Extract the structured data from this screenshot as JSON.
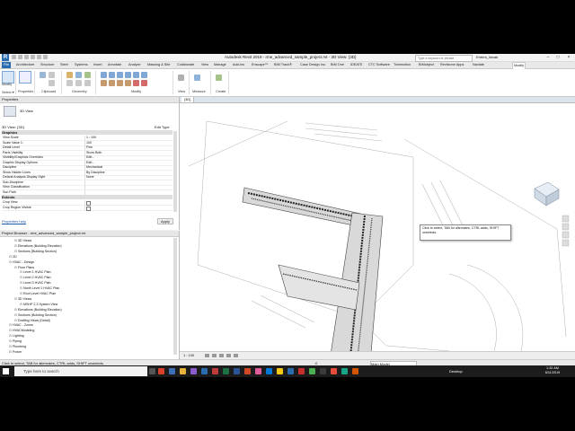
{
  "window": {
    "title": "Autodesk Revit 2019 - rme_advanced_sample_project.rvt - 3D View: {3D}",
    "search_placeholder": "Type a keyword or phrase",
    "user": "Erdem_ilovak"
  },
  "tabs": [
    "File",
    "Architecture",
    "Structure",
    "Steel",
    "Systems",
    "Insert",
    "Annotate",
    "Analyze",
    "Massing & Site",
    "Collaborate",
    "View",
    "Manage",
    "Add-Ins",
    "Enscape™",
    "BIM Track®",
    "Cove.Tool",
    "Case Design Inc.",
    "BIM One",
    "IDEATE",
    "CTC Software",
    "Twinmotion",
    "BIMobject",
    "Naviate",
    "Revitzone Apps",
    "Modify"
  ],
  "ribbon": {
    "panels": [
      "Select ▾",
      "Properties",
      "Clipboard",
      "Geometry",
      "Modify",
      "View",
      "Measure",
      "Create"
    ],
    "modify_label": "Modify"
  },
  "properties": {
    "header": "Properties",
    "type_name": "3D View",
    "instance_selector": "3D View: {3D}",
    "edit_type": "Edit Type",
    "section_graphics": "Graphics",
    "rows": [
      {
        "k": "View Scale",
        "v": "1 : 100"
      },
      {
        "k": "Scale Value    1:",
        "v": "100"
      },
      {
        "k": "Detail Level",
        "v": "Fine"
      },
      {
        "k": "Parts Visibility",
        "v": "Show Both"
      },
      {
        "k": "Visibility/Graphics Overrides",
        "v": "Edit..."
      },
      {
        "k": "Graphic Display Options",
        "v": "Edit..."
      },
      {
        "k": "Discipline",
        "v": "Mechanical"
      },
      {
        "k": "Show Hidden Lines",
        "v": "By Discipline"
      },
      {
        "k": "Default Analysis Display Style",
        "v": "None"
      },
      {
        "k": "Sub-Discipline",
        "v": ""
      },
      {
        "k": "View Classification",
        "v": ""
      },
      {
        "k": "Sun Path",
        "v": ""
      }
    ],
    "section_extents": "Extents",
    "extent_rows": [
      {
        "k": "Crop View",
        "v": ""
      },
      {
        "k": "Crop Region Visible",
        "v": ""
      }
    ],
    "help_link": "Properties help",
    "apply": "Apply"
  },
  "browser": {
    "header": "Project Browser - rme_advanced_sample_project.rvt",
    "items": [
      {
        "t": "3D Views",
        "d": 2
      },
      {
        "t": "Elevations (Building Elevation)",
        "d": 2
      },
      {
        "t": "Sections (Building Section)",
        "d": 2
      },
      {
        "t": "2D",
        "d": 1
      },
      {
        "t": "HVAC - Design",
        "d": 1
      },
      {
        "t": "Floor Plans",
        "d": 2
      },
      {
        "t": "Level 1 HVAC Plan",
        "d": 3
      },
      {
        "t": "Level 2 HVAC Plan",
        "d": 3
      },
      {
        "t": "Level 3 HVAC Plan",
        "d": 3
      },
      {
        "t": "North Level 1 HVAC Plan",
        "d": 3
      },
      {
        "t": "Roof Level HVAC Plan",
        "d": 3
      },
      {
        "t": "3D Views",
        "d": 2
      },
      {
        "t": "MSHP 2-3 System View",
        "d": 3
      },
      {
        "t": "Elevations (Building Elevation)",
        "d": 2
      },
      {
        "t": "Sections (Building Section)",
        "d": 2
      },
      {
        "t": "Drafting Views (Detail)",
        "d": 2
      },
      {
        "t": "HVAC - Zones",
        "d": 1
      },
      {
        "t": "HVACModeling",
        "d": 1
      },
      {
        "t": "Lighting",
        "d": 1
      },
      {
        "t": "Piping",
        "d": 1
      },
      {
        "t": "Plumbing",
        "d": 1
      },
      {
        "t": "Power",
        "d": 1
      }
    ]
  },
  "view": {
    "tab_label": "{3D}",
    "tooltip": "Click to select, TAB for alternates, CTRL adds, SHIFT unselects.",
    "scale": "1 : 100"
  },
  "status": {
    "text": "Click to select, TAB for alternates, CTRL adds, SHIFT unselects.",
    "model": "Main Model",
    "zero": ":0"
  },
  "taskbar": {
    "search": "Type here to search",
    "desktop": "Desktop",
    "time": "1:32 AM",
    "date": "6/11/2019"
  }
}
